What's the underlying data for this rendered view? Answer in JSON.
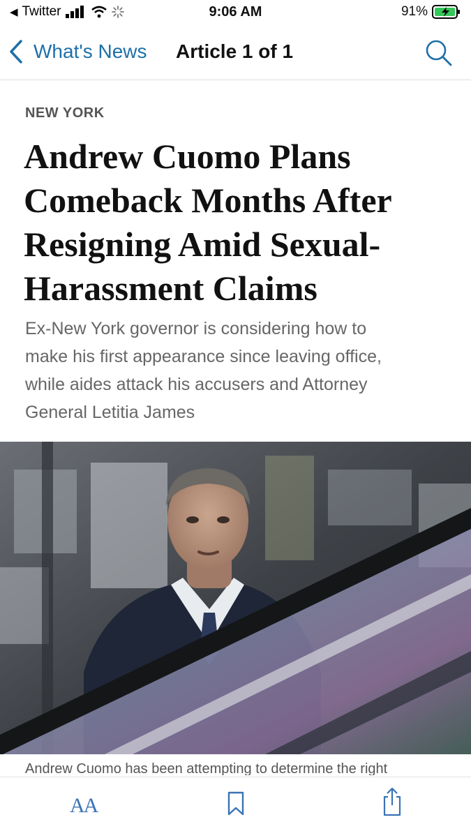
{
  "status_bar": {
    "back_app": "Twitter",
    "time": "9:06 AM",
    "battery": "91%"
  },
  "nav": {
    "back_label": "What's News",
    "title": "Article 1 of 1"
  },
  "article": {
    "kicker": "NEW YORK",
    "headline_lines": [
      "Andrew Cuomo Plans",
      "Comeback Months After",
      "Resigning Amid Sexual-",
      "Harassment Claims"
    ],
    "dek_lines": [
      "Ex-New York governor is considering how to",
      "make his first appearance since leaving office,",
      "while aides attack his accusers and Attorney",
      "General Letitia James"
    ],
    "caption": "Andrew Cuomo has been attempting to determine the right"
  },
  "tabbar": {
    "text_size_label": "AA"
  },
  "colors": {
    "accent": "#1e6fa8",
    "icon_tab": "#3a73b5"
  }
}
